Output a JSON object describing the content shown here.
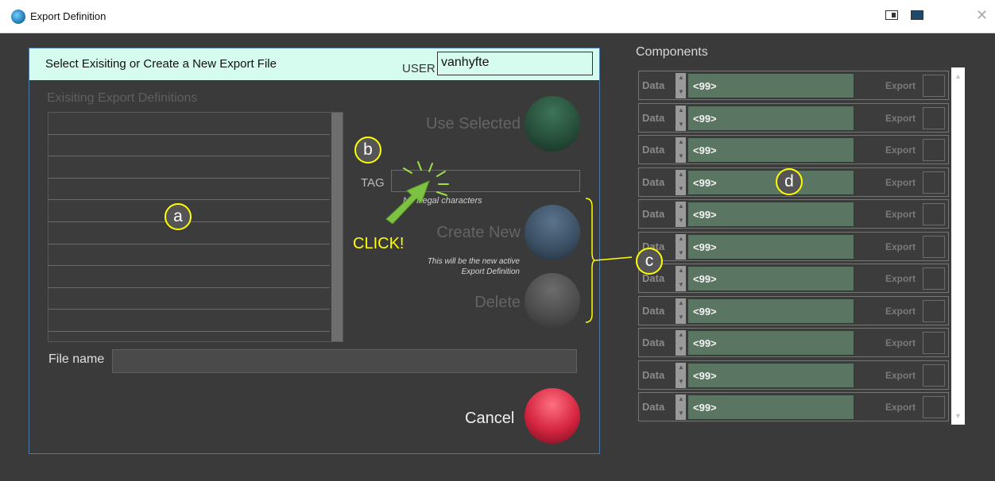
{
  "window": {
    "title": "Export Definition"
  },
  "header": {
    "title": "Select Exisiting or Create a New Export File",
    "user_label": "USER",
    "user_value": "vanhyfte"
  },
  "list": {
    "label": "Exisiting Export Definitions",
    "rows": [
      "",
      "",
      "",
      "",
      "",
      "",
      "",
      "",
      "",
      ""
    ]
  },
  "buttons": {
    "use_selected": "Use Selected",
    "create_new": "Create New",
    "delete": "Delete",
    "cancel": "Cancel"
  },
  "tag": {
    "label": "TAG",
    "value": "",
    "hint": "No illegal characters"
  },
  "create_hint": {
    "line1": "This will be the new active",
    "line2": "Export Definition"
  },
  "file": {
    "label": "File name",
    "value": ""
  },
  "components": {
    "title": "Components",
    "rows": [
      {
        "data_label": "Data",
        "value": "<99>",
        "export_label": "Export"
      },
      {
        "data_label": "Data",
        "value": "<99>",
        "export_label": "Export"
      },
      {
        "data_label": "Data",
        "value": "<99>",
        "export_label": "Export"
      },
      {
        "data_label": "Data",
        "value": "<99>",
        "export_label": "Export"
      },
      {
        "data_label": "Data",
        "value": "<99>",
        "export_label": "Export"
      },
      {
        "data_label": "Data",
        "value": "<99>",
        "export_label": "Export"
      },
      {
        "data_label": "Data",
        "value": "<99>",
        "export_label": "Export"
      },
      {
        "data_label": "Data",
        "value": "<99>",
        "export_label": "Export"
      },
      {
        "data_label": "Data",
        "value": "<99>",
        "export_label": "Export"
      },
      {
        "data_label": "Data",
        "value": "<99>",
        "export_label": "Export"
      },
      {
        "data_label": "Data",
        "value": "<99>",
        "export_label": "Export"
      }
    ]
  },
  "annotations": {
    "a": "a",
    "b": "b",
    "c": "c",
    "d": "d",
    "click": "CLICK!"
  },
  "colors": {
    "header_bg": "#d6fbef",
    "use_selected_orb": "#2f5e45",
    "create_orb": "#46596e",
    "delete_orb": "#555555",
    "cancel_orb": "#d42440",
    "marker": "#ffff00",
    "arrow": "#7dc242"
  }
}
